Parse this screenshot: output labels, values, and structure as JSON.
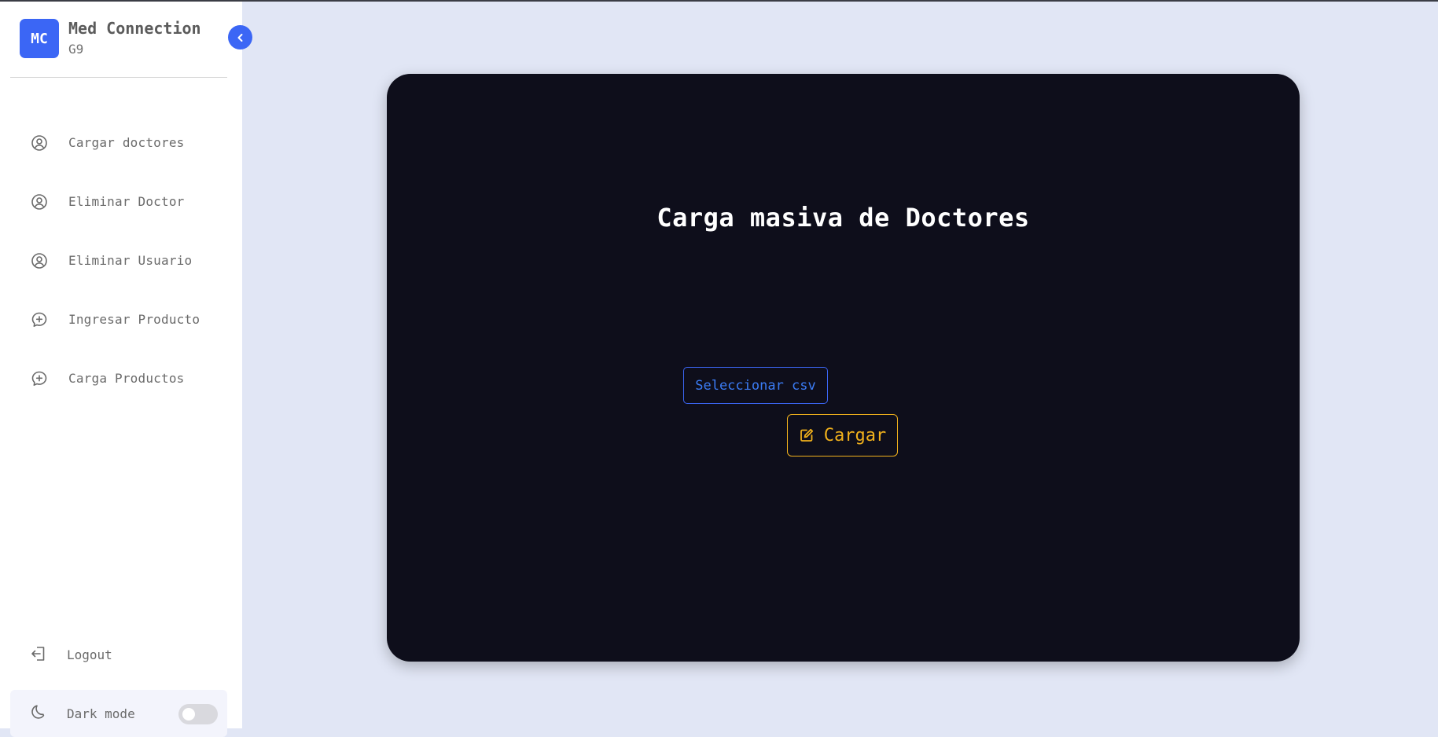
{
  "brand": {
    "logo_text": "MC",
    "name": "Med Connection",
    "subtitle": "G9",
    "accent_color": "#3b66f5"
  },
  "sidebar": {
    "collapse_icon": "chevron-left-icon",
    "items": [
      {
        "label": "Cargar doctores",
        "icon": "user-circle-icon"
      },
      {
        "label": "Eliminar Doctor",
        "icon": "user-circle-icon"
      },
      {
        "label": "Eliminar Usuario",
        "icon": "user-circle-icon"
      },
      {
        "label": "Ingresar Producto",
        "icon": "chat-plus-icon"
      },
      {
        "label": "Carga Productos",
        "icon": "chat-plus-icon"
      }
    ],
    "logout_label": "Logout",
    "dark_mode_label": "Dark mode",
    "dark_mode_enabled": false
  },
  "main": {
    "title": "Carga masiva de Doctores",
    "select_csv_label": "Seleccionar csv",
    "load_label": "Cargar",
    "load_icon": "edit-icon",
    "card_color": "#0e0e1b",
    "load_color": "#f1b11c"
  }
}
